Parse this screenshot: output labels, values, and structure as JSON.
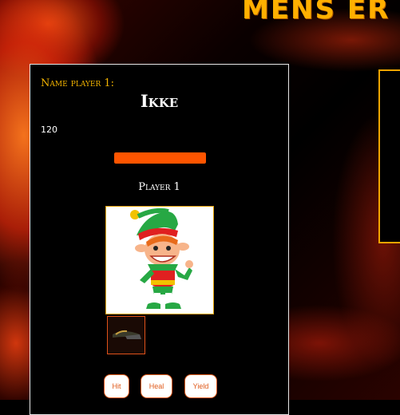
{
  "header": {
    "site_title": "MENS ER"
  },
  "player_card": {
    "name_label": "Name player 1:",
    "player_name": "Ikke",
    "health_value": "120",
    "health_fraction": 1.0,
    "player_label": "Player 1",
    "avatar_icon": "elf-character-icon",
    "weapon_icon": "folding-knife-icon"
  },
  "actions": {
    "hit_label": "Hit",
    "heal_label": "Heal",
    "yield_label": "Yield"
  },
  "colors": {
    "accent": "#f2b300",
    "health_bar": "#ff5500",
    "button_border": "#e05a1a"
  }
}
